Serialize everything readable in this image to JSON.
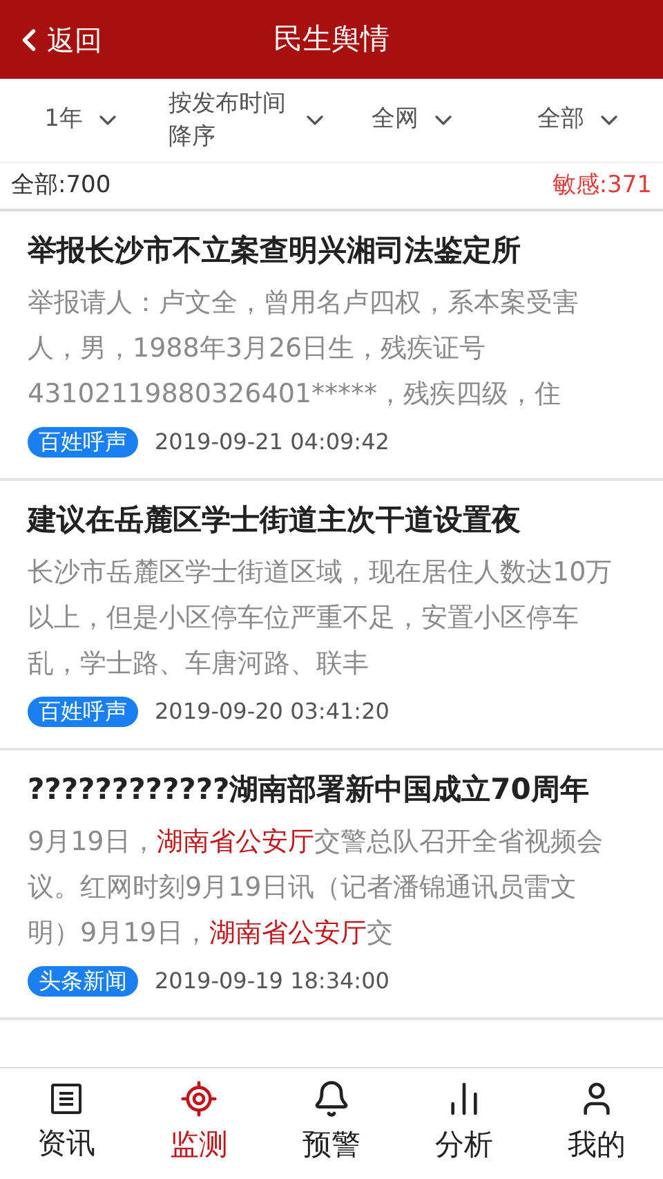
{
  "header": {
    "back": "返回",
    "title": "民生舆情"
  },
  "filters": [
    {
      "label": "1年"
    },
    {
      "label": "按发布时间降序"
    },
    {
      "label": "全网"
    },
    {
      "label": "全部"
    }
  ],
  "summary": {
    "total": "全部:700",
    "sensitive": "敏感:371"
  },
  "articles": [
    {
      "title": "举报长沙市不立案查明兴湘司法鉴定所",
      "body": [
        {
          "text": "举报请人：卢文全，曾用名卢四权，系本案受害人，男，1988年3月26日生，残疾证号43102119880326401*****，残疾四级，住",
          "highlight": false
        }
      ],
      "tag": "百姓呼声",
      "time": "2019-09-21 04:09:42"
    },
    {
      "title": "建议在岳麓区学士街道主次干道设置夜",
      "body": [
        {
          "text": "长沙市岳麓区学士街道区域，现在居住人数达10万以上，但是小区停车位严重不足，安置小区停车乱，学士路、车唐河路、联丰",
          "highlight": false
        }
      ],
      "tag": "百姓呼声",
      "time": "2019-09-20 03:41:20"
    },
    {
      "title": "????????????湖南部署新中国成立70周年",
      "body": [
        {
          "text": "9月19日，",
          "highlight": false
        },
        {
          "text": "湖南省公安厅",
          "highlight": true
        },
        {
          "text": "交警总队召开全省视频会议。红网时刻9月19日讯（记者潘锦通讯员雷文明）9月19日，",
          "highlight": false
        },
        {
          "text": "湖南省公安厅",
          "highlight": true
        },
        {
          "text": "交",
          "highlight": false
        }
      ],
      "tag": "头条新闻",
      "time": "2019-09-19 18:34:00"
    }
  ],
  "nav": [
    {
      "label": "资讯",
      "kind": "news",
      "selected": false
    },
    {
      "label": "监测",
      "kind": "target",
      "selected": true
    },
    {
      "label": "预警",
      "kind": "bell",
      "selected": false
    },
    {
      "label": "分析",
      "kind": "bars",
      "selected": false
    },
    {
      "label": "我的",
      "kind": "user",
      "selected": false
    }
  ]
}
